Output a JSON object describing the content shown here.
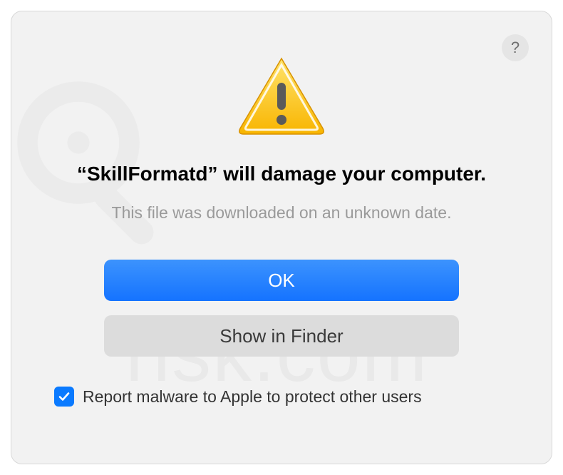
{
  "dialog": {
    "help_label": "?",
    "title": "“SkillFormatd” will damage your computer.",
    "subtitle": "This file was downloaded on an unknown date.",
    "ok_label": "OK",
    "show_in_finder_label": "Show in Finder",
    "checkbox_label": "Report malware to Apple to protect other users",
    "checkbox_checked": true
  },
  "icons": {
    "warning": "warning-triangle-icon",
    "help": "help-icon",
    "checkmark": "checkmark-icon"
  },
  "colors": {
    "primary_button": "#1573ff",
    "secondary_button": "#dcdcdc",
    "checkbox_checked_bg": "#0a7aff",
    "dialog_bg": "#f2f2f2",
    "title_text": "#000000",
    "subtitle_text": "#9a9a9a"
  },
  "watermark_text": "risk.com"
}
